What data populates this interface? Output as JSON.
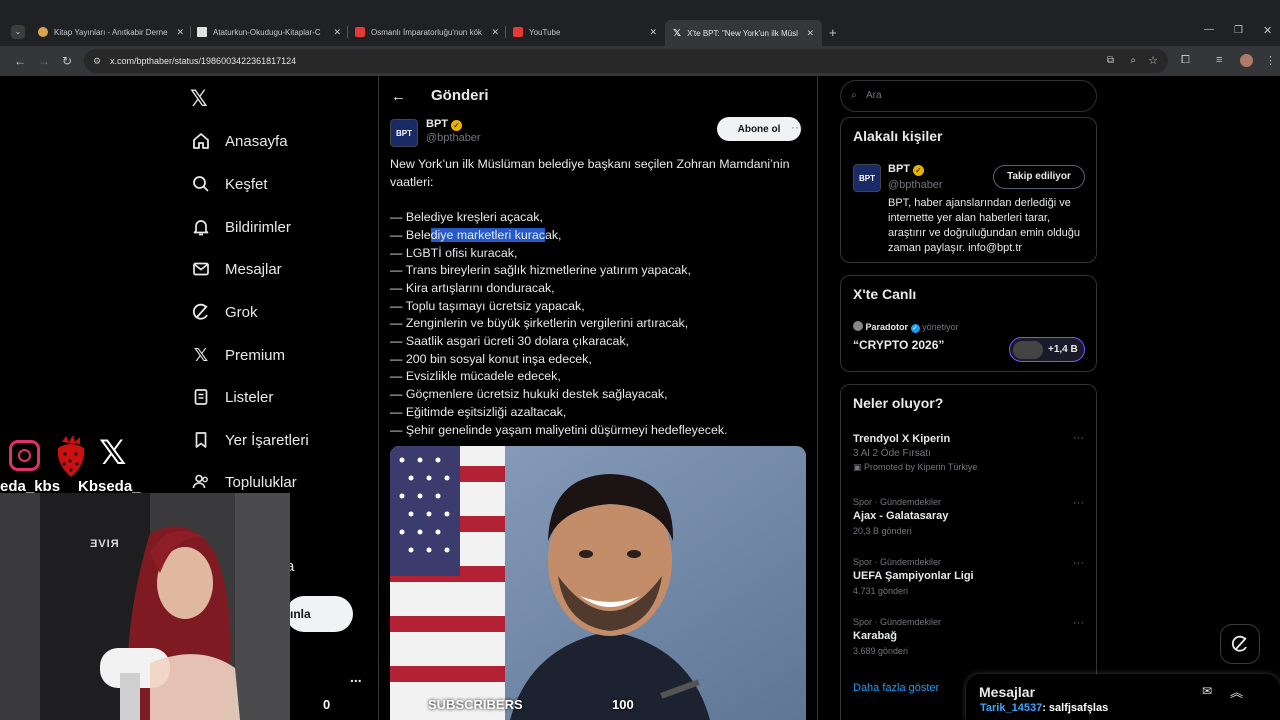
{
  "browser": {
    "tabs": [
      {
        "title": "Kitap Yayınları - Anıtkabir Derne",
        "color": "#d7a64b"
      },
      {
        "title": "Ataturkun-Okudugu-Kitaplar-C",
        "color": "#e0e0e0"
      },
      {
        "title": "Osmanlı İmparatorluğu'nun kök",
        "color": "#e53935"
      },
      {
        "title": "YouTube",
        "color": "#e53935"
      },
      {
        "title": "X'te BPT: \"New York'un ilk Müsl",
        "color": "#ffffff"
      }
    ],
    "url": "x.com/bpthaber/status/1986003422361817124"
  },
  "nav": {
    "items": [
      {
        "label": "Anasayfa",
        "icon": "home-icon"
      },
      {
        "label": "Keşfet",
        "icon": "search-icon"
      },
      {
        "label": "Bildirimler",
        "icon": "bell-icon"
      },
      {
        "label": "Mesajlar",
        "icon": "envelope-icon"
      },
      {
        "label": "Grok",
        "icon": "grok-icon"
      },
      {
        "label": "Premium",
        "icon": "x-icon"
      },
      {
        "label": "Listeler",
        "icon": "list-icon"
      },
      {
        "label": "Yer İşaretleri",
        "icon": "bookmark-icon"
      },
      {
        "label": "Topluluklar",
        "icon": "people-icon"
      }
    ],
    "partial_label": "a",
    "post_button_partial": "ınla",
    "more": "..."
  },
  "post": {
    "header_title": "Gönderi",
    "author_name": "BPT",
    "author_handle": "@bpthaber",
    "avatar_text": "BPT",
    "follow_label": "Abone ol",
    "intro_line1": "New York’un ilk Müslüman belediye başkanı seçilen Zohran Mamdani’nin",
    "intro_line2": "vaatleri:",
    "promise_2_pre": "— Bele",
    "promise_2_hl": "diye marketleri kurac",
    "promise_2_post": "ak,",
    "promises": [
      "— Belediye kreşleri açacak,",
      "— LGBTİ ofisi kuracak,",
      "— Trans bireylerin sağlık hizmetlerine yatırım yapacak,",
      "— Kira artışlarını donduracak,",
      "— Toplu taşımayı ücretsiz yapacak,",
      "— Zenginlerin ve büyük şirketlerin vergilerini artıracak,",
      "— Saatlik asgari ücreti 30 dolara çıkaracak,",
      "— 200 bin sosyal konut inşa edecek,",
      "— Evsizlikle mücadele edecek,",
      "— Göçmenlere ücretsiz hukuki destek sağlayacak,",
      "— Eğitimde eşitsizliği azaltacak,",
      "— Şehir genelinde yaşam maliyetini düşürmeyi hedefleyecek."
    ]
  },
  "right": {
    "search_placeholder": "Ara",
    "related_title": "Alakalı kişiler",
    "related_name": "BPT",
    "related_handle": "@bpthaber",
    "related_button": "Takip ediliyor",
    "related_bio": [
      "BPT, haber ajanslarından derlediği ve",
      "internette yer alan haberleri tarar,",
      "araştırır ve doğruluğundan emin olduğu",
      "zaman paylaşır. info@bpt.tr"
    ],
    "live_title": "X'te Canlı",
    "live_host": "Paradotor",
    "live_host_suffix": "yönetiyor",
    "live_name": "“CRYPTO 2026”",
    "live_count": "+1,4 B",
    "trends_title": "Neler oluyor?",
    "trends": [
      {
        "meta": "",
        "name": "Trendyol X Kiperin",
        "sub": "3 Al 2 Öde Fırsatı",
        "extra": "Promoted by Kiperin Türkiye"
      },
      {
        "meta": "Spor · Gündemdekiler",
        "name": "Ajax - Galatasaray",
        "sub": "20,3 B gönderi",
        "extra": ""
      },
      {
        "meta": "Spor · Gündemdekiler",
        "name": "UEFA Şampiyonlar Ligi",
        "sub": "4.731 gönderi",
        "extra": ""
      },
      {
        "meta": "Spor · Gündemdekiler",
        "name": "Karabağ",
        "sub": "3.689 gönderi",
        "extra": ""
      }
    ],
    "show_more": "Daha fazla göster"
  },
  "messages": {
    "title": "Mesajlar",
    "chat_user": "Tarik_14537",
    "chat_text": ": salfjsafşlas"
  },
  "overlay": {
    "handle1": "eda_kbs",
    "handle2": "Kbseda_",
    "subscribers_label": "SUBSCRIBERS",
    "subscribers_value": "100",
    "counter": "0",
    "chair_text": "ƎVIЯ"
  }
}
